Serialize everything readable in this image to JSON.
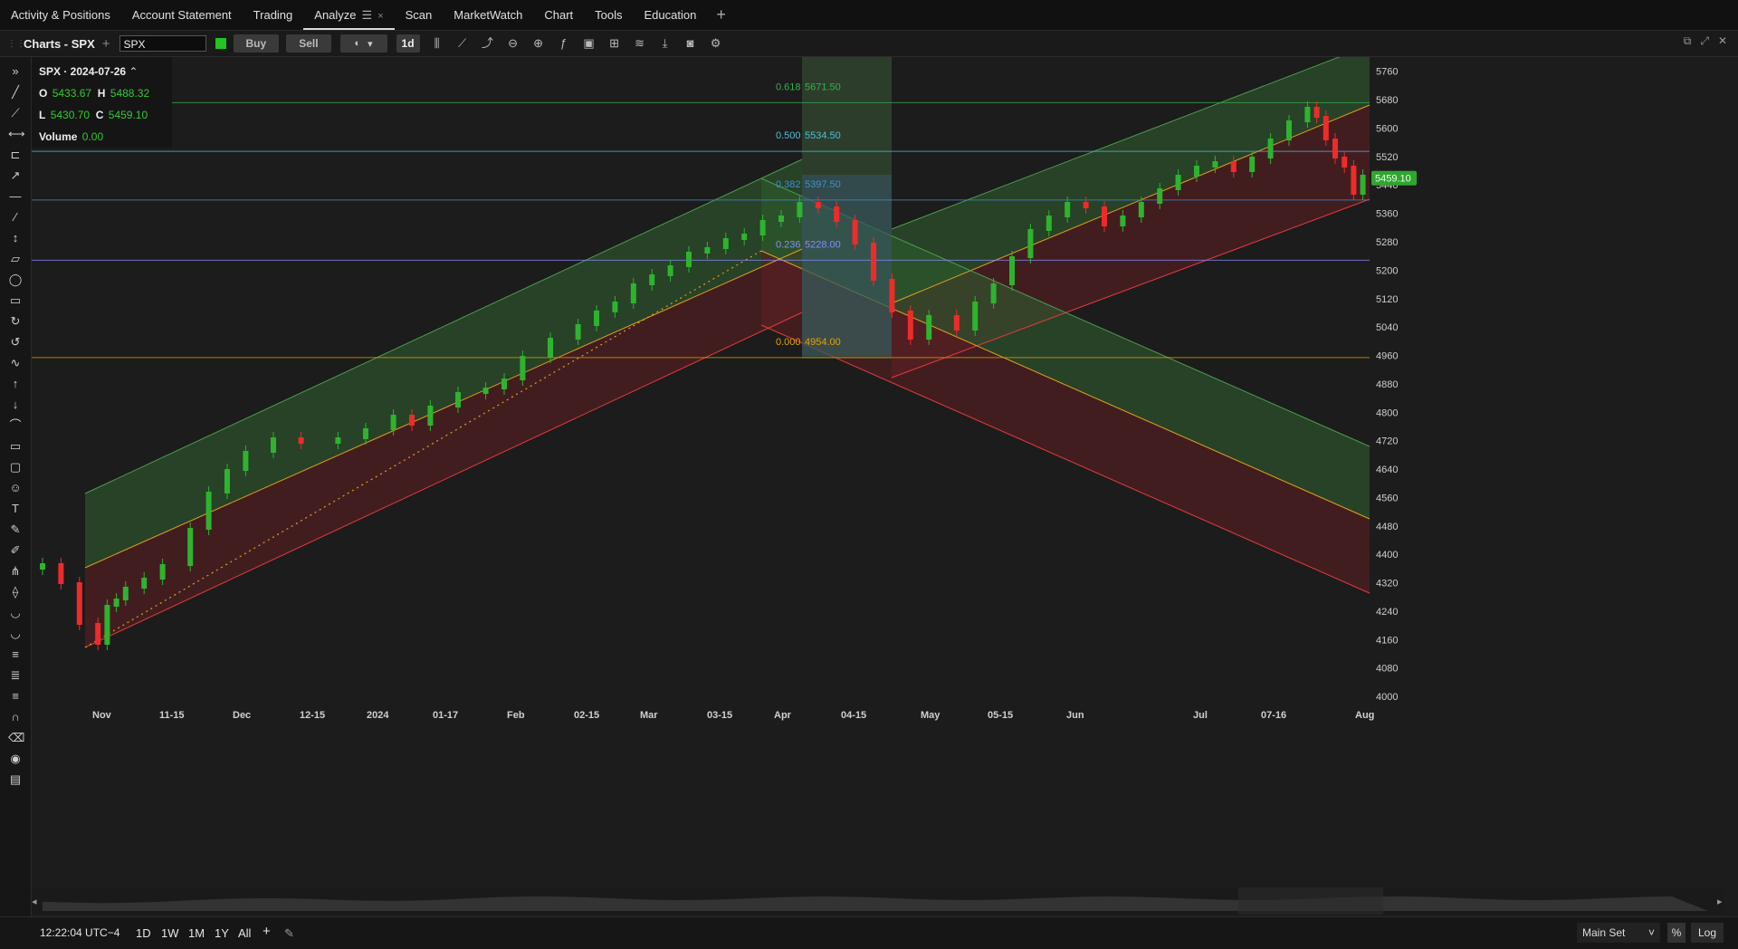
{
  "topnav": {
    "tabs": [
      "Activity & Positions",
      "Account Statement",
      "Trading",
      "Analyze",
      "Scan",
      "MarketWatch",
      "Chart",
      "Tools",
      "Education"
    ],
    "active_tab": "Analyze",
    "close_glyph": "×",
    "menu_glyph": "☰",
    "plus_glyph": "+"
  },
  "toolbar": {
    "title": "Charts - SPX",
    "symbol": "SPX",
    "buy_label": "Buy",
    "sell_label": "Sell",
    "period_label": "1d",
    "link_color": "#22c322"
  },
  "legend": {
    "header": "SPX · 2024-07-26",
    "o_label": "O",
    "o": "5433.67",
    "h_label": "H",
    "h": "5488.32",
    "l_label": "L",
    "l": "5430.70",
    "c_label": "C",
    "c": "5459.10",
    "volume_label": "Volume",
    "volume": "0.00"
  },
  "bottom": {
    "time": "12:22:04 UTC−4",
    "ranges": [
      "1D",
      "1W",
      "1M",
      "1Y",
      "All"
    ],
    "plus_glyph": "+",
    "main_set": "Main Set",
    "pct": "%",
    "log": "Log"
  },
  "chart_data": {
    "type": "candlestick",
    "symbol": "SPX",
    "y_ticks": [
      4000,
      4080,
      4160,
      4240,
      4320,
      4400,
      4480,
      4560,
      4640,
      4720,
      4800,
      4880,
      4960,
      5040,
      5120,
      5200,
      5280,
      5360,
      5440,
      5520,
      5600,
      5680,
      5760
    ],
    "ylim": [
      3985,
      5800
    ],
    "x_ticks": [
      "Nov",
      "11-15",
      "Dec",
      "12-15",
      "2024",
      "01-17",
      "Feb",
      "02-15",
      "Mar",
      "03-15",
      "Apr",
      "04-15",
      "May",
      "05-15",
      "Jun",
      "Jul",
      "07-16",
      "Aug"
    ],
    "last_price": "5459.10",
    "fib_levels": [
      {
        "ratio": "0.000",
        "price": "4954.00",
        "color": "#e5a300"
      },
      {
        "ratio": "0.236",
        "price": "5228.00",
        "color": "#8a8aff"
      },
      {
        "ratio": "0.382",
        "price": "5397.50",
        "color": "#3f8fd0"
      },
      {
        "ratio": "0.500",
        "price": "5534.50",
        "color": "#4cc0d9"
      },
      {
        "ratio": "0.618",
        "price": "5671.50",
        "color": "#39b04a"
      }
    ],
    "colors": {
      "up": "#2fb32f",
      "down": "#ee2b2b",
      "channel_up": "#2e5a2e",
      "channel_down": "#5a1f24"
    }
  }
}
